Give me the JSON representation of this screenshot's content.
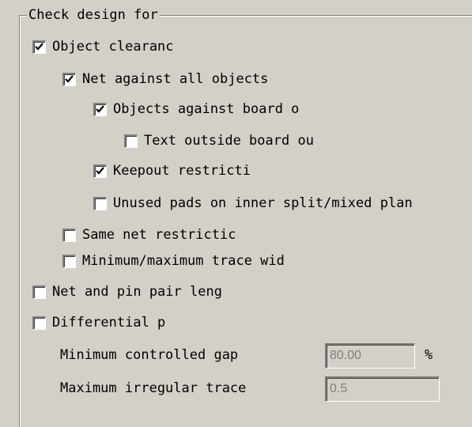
{
  "group": {
    "title": "Check design for"
  },
  "checks": [
    {
      "label": "Object clearanc",
      "checked": true
    },
    {
      "label": "Net against all objects",
      "checked": true
    },
    {
      "label": "Objects against board o",
      "checked": true
    },
    {
      "label": "Text outside board ou",
      "checked": false
    },
    {
      "label": "Keepout restricti",
      "checked": true
    },
    {
      "label": "Unused pads on inner split/mixed plan",
      "checked": false
    },
    {
      "label": "Same net restrictic",
      "checked": false
    },
    {
      "label": "Minimum/maximum trace wid",
      "checked": false
    },
    {
      "label": "Net and pin pair leng",
      "checked": false
    },
    {
      "label": "Differential p",
      "checked": false
    }
  ],
  "fields": {
    "min_gap_label": "Minimum controlled gap",
    "min_gap_value": "80.00",
    "min_gap_unit": "%",
    "max_irregular_label": "Maximum irregular trace",
    "max_irregular_value": "0.5"
  }
}
